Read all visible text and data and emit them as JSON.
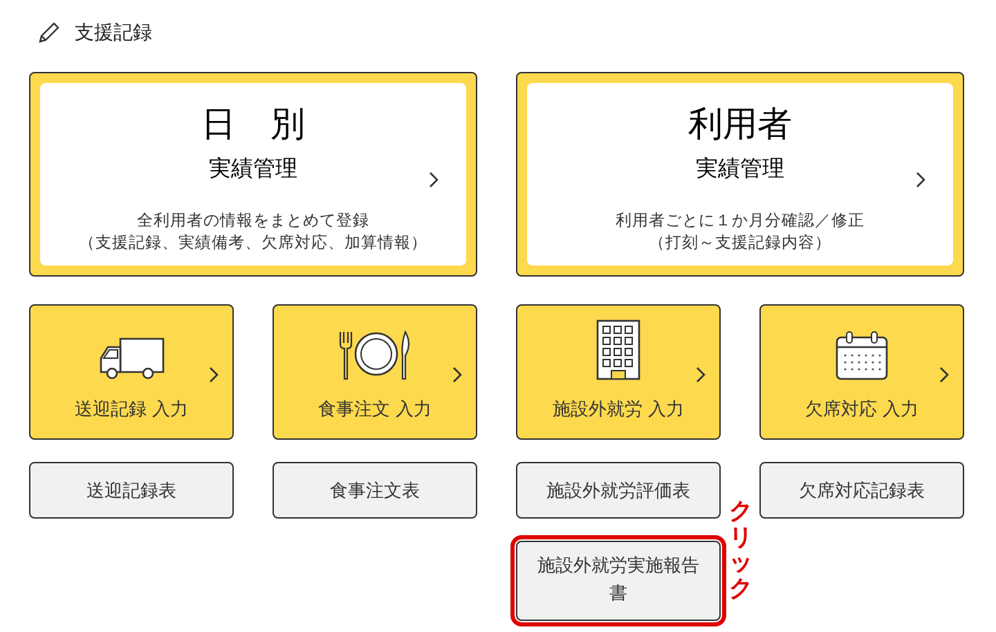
{
  "header": {
    "title": "支援記録"
  },
  "main_cards": [
    {
      "title": "日　別",
      "subtitle": "実績管理",
      "description": [
        "全利用者の情報をまとめて登録",
        "（支援記録、実績備考、欠席対応、加算情報）"
      ]
    },
    {
      "title": "利用者",
      "subtitle": "実績管理",
      "description": [
        "利用者ごとに１か月分確認／修正",
        "（打刻～支援記録内容）"
      ]
    }
  ],
  "input_cards": [
    {
      "kind": "truck",
      "label": "送迎記録 入力"
    },
    {
      "kind": "meal",
      "label": "食事注文 入力"
    },
    {
      "kind": "building",
      "label": "施設外就労 入力"
    },
    {
      "kind": "calendar",
      "label": "欠席対応 入力"
    }
  ],
  "report_buttons": [
    {
      "label": "送迎記録表"
    },
    {
      "label": "食事注文表"
    },
    {
      "label": "施設外就労評価表"
    },
    {
      "label": "欠席対応記録表"
    }
  ],
  "extra_button": {
    "label": "施設外就労実施報告書",
    "highlighted": true
  },
  "annotation": "クリック"
}
